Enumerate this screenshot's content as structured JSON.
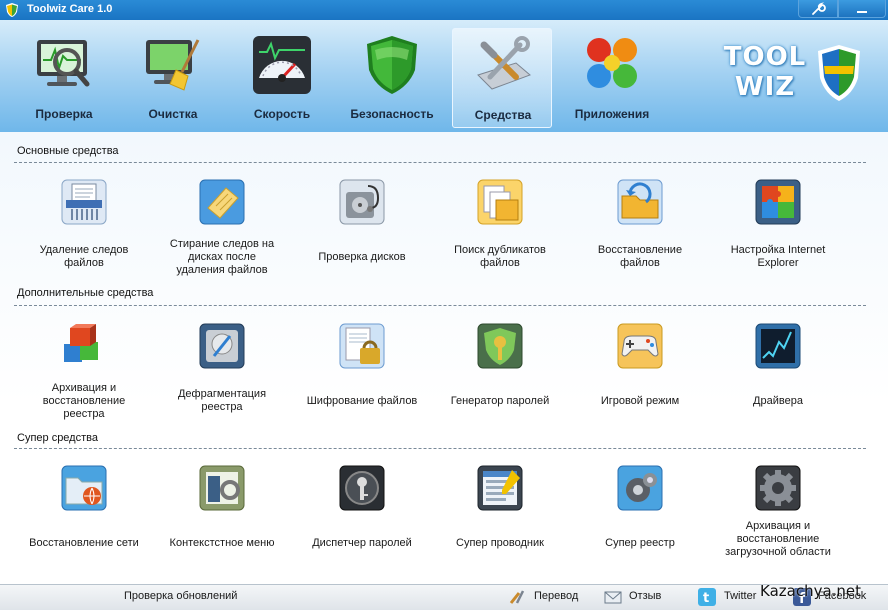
{
  "window": {
    "title": "Toolwiz Care 1.0"
  },
  "nav": {
    "items": [
      {
        "label": "Проверка",
        "icon": "monitor-heartbeat-icon"
      },
      {
        "label": "Очистка",
        "icon": "monitor-broom-icon"
      },
      {
        "label": "Скорость",
        "icon": "speedometer-icon"
      },
      {
        "label": "Безопасность",
        "icon": "shield-icon"
      },
      {
        "label": "Средства",
        "icon": "tools-icon",
        "active": true
      },
      {
        "label": "Приложения",
        "icon": "apps-icon"
      }
    ]
  },
  "logo": {
    "line1": "TOOL",
    "line2": "WIZ"
  },
  "sections": [
    {
      "title": "Основные средства",
      "tools": [
        {
          "label": "Удаление следов файлов",
          "icon": "shredder-icon"
        },
        {
          "label": "Стирание следов на дисках после удаления файлов",
          "icon": "eraser-icon"
        },
        {
          "label": "Проверка дисков",
          "icon": "disk-check-icon"
        },
        {
          "label": "Поиск дубликатов файлов",
          "icon": "duplicate-files-icon"
        },
        {
          "label": "Восстановление файлов",
          "icon": "file-recovery-icon"
        },
        {
          "label": "Настройка Internet Explorer",
          "icon": "puzzle-icon"
        }
      ]
    },
    {
      "title": "Дополнительные средства",
      "tools": [
        {
          "label": "Архивация и восстановление реестра",
          "icon": "registry-cubes-icon"
        },
        {
          "label": "Дефрагментация реестра",
          "icon": "defrag-icon"
        },
        {
          "label": "Шифрование файлов",
          "icon": "file-lock-icon"
        },
        {
          "label": "Генератор паролей",
          "icon": "key-shield-icon"
        },
        {
          "label": "Игровой режим",
          "icon": "gamepad-icon"
        },
        {
          "label": "Драйвера",
          "icon": "driver-chart-icon"
        }
      ]
    },
    {
      "title": "Супер средства",
      "tools": [
        {
          "label": "Восстановление сети",
          "icon": "network-folder-icon"
        },
        {
          "label": "Контекстстное меню",
          "icon": "context-menu-icon"
        },
        {
          "label": "Диспетчер паролей",
          "icon": "password-manager-icon"
        },
        {
          "label": "Супер проводник",
          "icon": "explorer-icon"
        },
        {
          "label": "Супер реестр",
          "icon": "super-registry-icon"
        },
        {
          "label": "Архивация и восстановление загрузочной области",
          "icon": "boot-gear-icon"
        }
      ]
    }
  ],
  "statusbar": {
    "check_updates": "Проверка обновлений",
    "translate": "Перевод",
    "feedback": "Отзыв",
    "twitter": "Twitter",
    "facebook": "Facebook"
  },
  "watermark": "Kazachya.net",
  "colors": {
    "title_bar": "#1a74c3",
    "header_gradient_top": "#d6ecfa",
    "header_gradient_bottom": "#6fb7ea",
    "divider": "#7a8a99"
  }
}
